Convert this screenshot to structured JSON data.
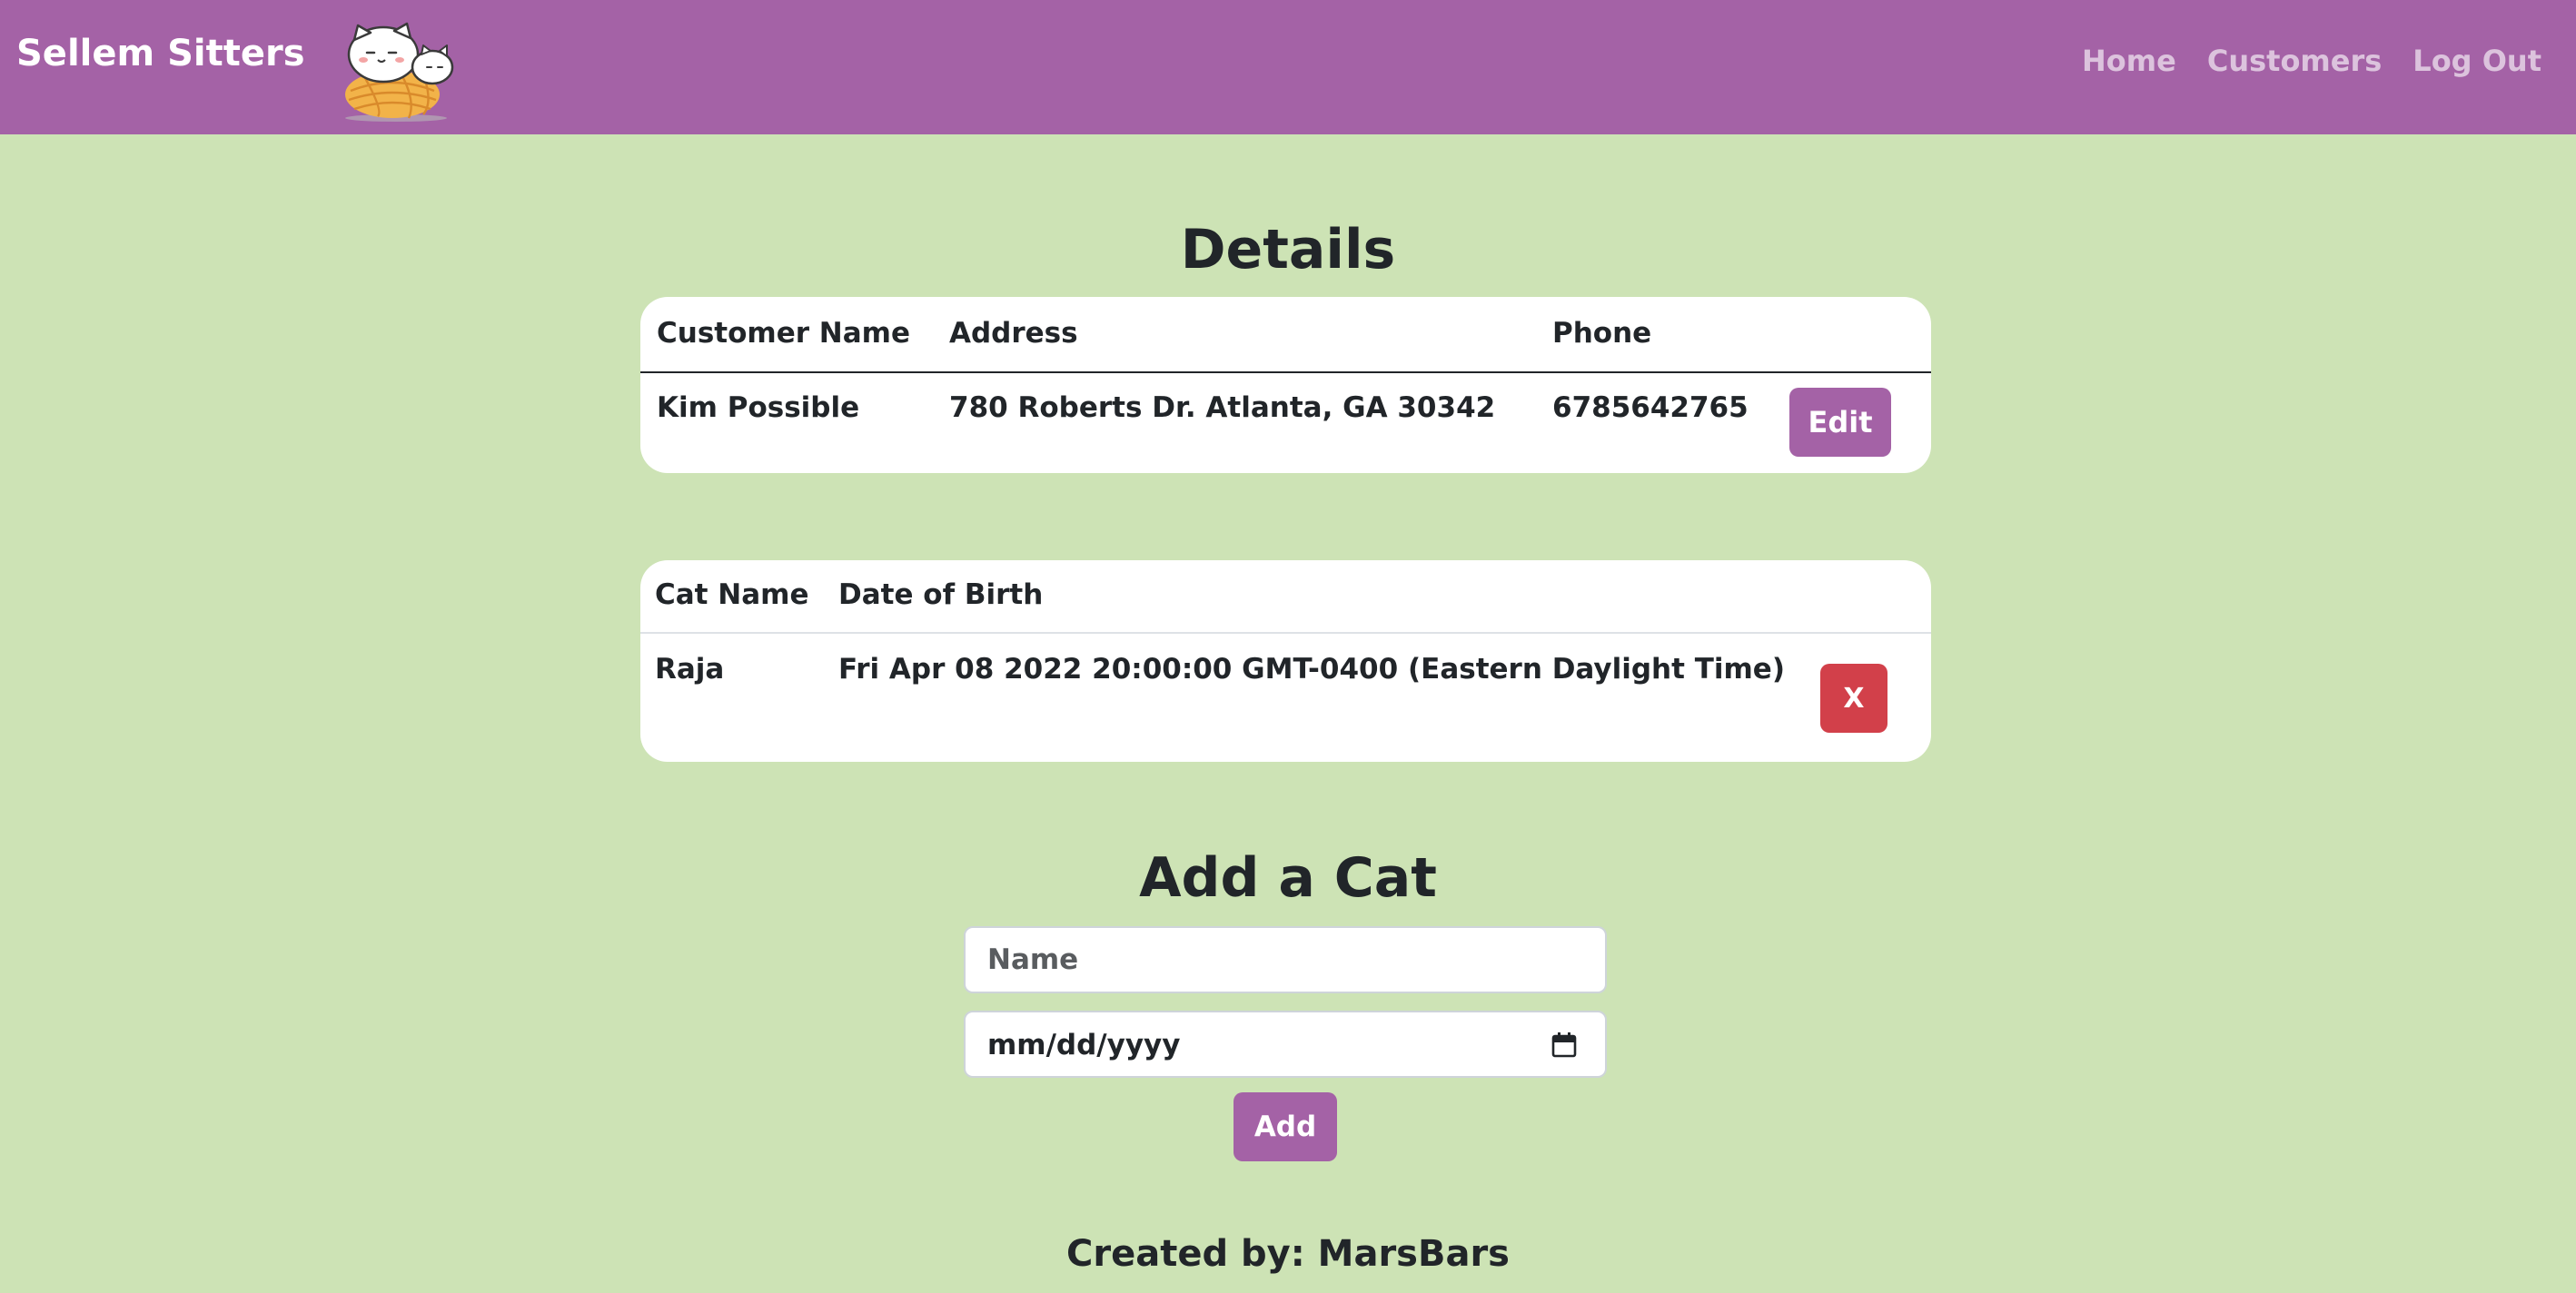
{
  "navbar": {
    "brand": "Sellem Sitters",
    "links": [
      "Home",
      "Customers",
      "Log Out"
    ]
  },
  "details": {
    "title": "Details",
    "headers": [
      "Customer Name",
      "Address",
      "Phone"
    ],
    "row": {
      "name": "Kim Possible",
      "address": "780 Roberts Dr. Atlanta, GA 30342",
      "phone": "6785642765"
    },
    "edit_label": "Edit"
  },
  "cats": {
    "headers": [
      "Cat Name",
      "Date of Birth"
    ],
    "rows": [
      {
        "name": "Raja",
        "dob": "Fri Apr 08 2022 20:00:00 GMT-0400 (Eastern Daylight Time)"
      }
    ],
    "delete_label": "X"
  },
  "add_cat": {
    "title": "Add a Cat",
    "name_placeholder": "Name",
    "date_placeholder": "mm/dd/yyyy",
    "add_label": "Add"
  },
  "footer": "Created by: MarsBars",
  "colors": {
    "navbar": "#a462a6",
    "background": "#cde3b5",
    "danger": "#d2404a"
  }
}
